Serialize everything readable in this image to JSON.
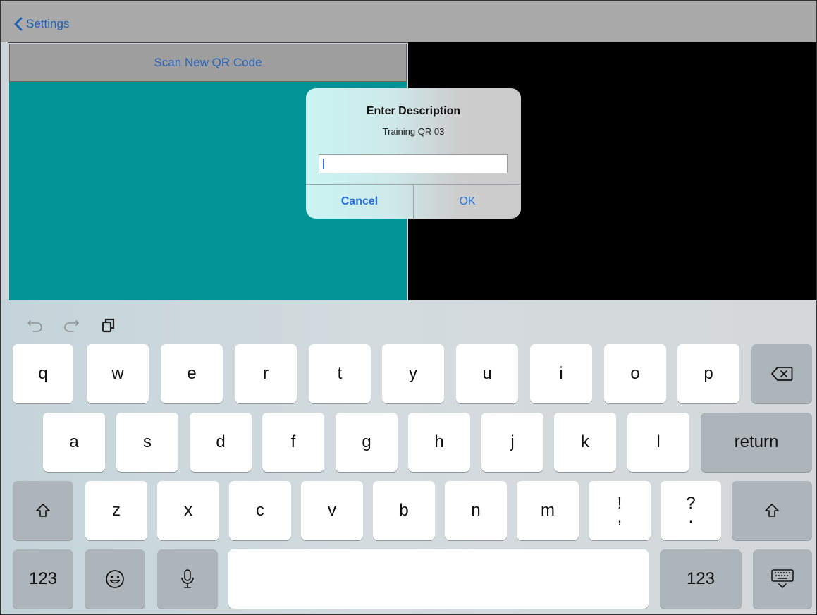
{
  "navbar": {
    "back_label": "Settings"
  },
  "scan_panel": {
    "header": "Scan New QR Code"
  },
  "alert": {
    "title": "Enter Description",
    "message": "Training QR 03",
    "input_value": "",
    "cancel_label": "Cancel",
    "ok_label": "OK"
  },
  "keyboard": {
    "row1": [
      "q",
      "w",
      "e",
      "r",
      "t",
      "y",
      "u",
      "i",
      "o",
      "p"
    ],
    "row2": [
      "a",
      "s",
      "d",
      "f",
      "g",
      "h",
      "j",
      "k",
      "l"
    ],
    "return_label": "return",
    "row3": [
      "z",
      "x",
      "c",
      "v",
      "b",
      "n",
      "m"
    ],
    "exclaim_top": "!",
    "exclaim_bottom": ",",
    "question_top": "?",
    "question_bottom": ".",
    "numbers_left": "123",
    "numbers_right": "123"
  },
  "colors": {
    "accent": "#2a73d8",
    "teal": "#029494",
    "navbar": "#a9a9a9"
  }
}
